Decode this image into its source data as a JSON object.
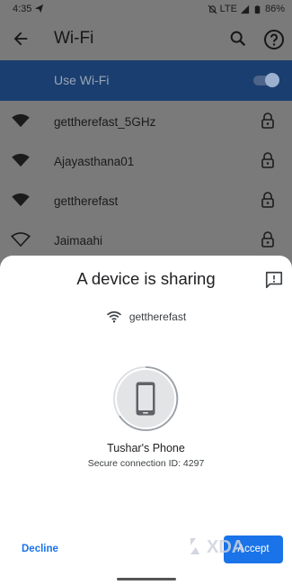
{
  "status_bar": {
    "time": "4:35",
    "network": "LTE",
    "battery": "86%"
  },
  "app_bar": {
    "title": "Wi-Fi",
    "icons": [
      "back-arrow-icon",
      "search-icon",
      "help-icon"
    ]
  },
  "use_wifi": {
    "label": "Use Wi-Fi",
    "enabled": true
  },
  "networks": [
    {
      "name": "gettherefast_5GHz",
      "secured": true
    },
    {
      "name": "Ajayasthana01",
      "secured": true
    },
    {
      "name": "gettherefast",
      "secured": true
    },
    {
      "name": "Jaimaahi",
      "secured": true
    }
  ],
  "sheet": {
    "title": "A device is sharing",
    "network_name": "gettherefast",
    "device_name": "Tushar's Phone",
    "connection_id": "Secure connection ID: 4297",
    "decline_label": "Decline",
    "accept_label": "Accept",
    "watermark": "XDA"
  },
  "colors": {
    "accent": "#1a73e8",
    "use_wifi_bar": "#1a3e6f",
    "scrim_bg": "#7a7a7a"
  }
}
